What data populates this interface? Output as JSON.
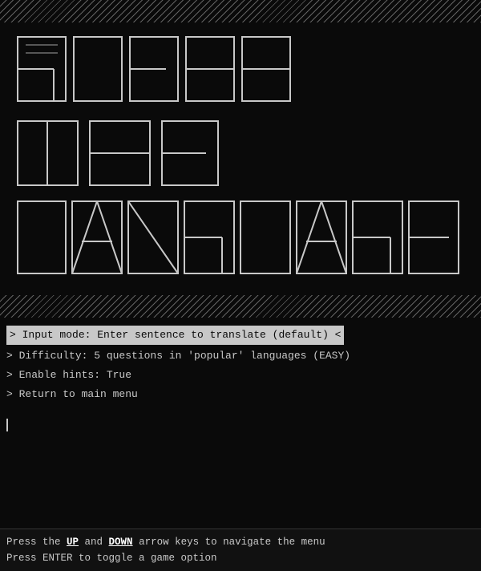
{
  "title": {
    "line1": "GUESS",
    "line2": "THE",
    "line3": "LANGUAGE"
  },
  "menu": {
    "items": [
      {
        "id": "input-mode",
        "text": "> Input mode: Enter sentence to translate (default) <",
        "selected": true
      },
      {
        "id": "difficulty",
        "text": "> Difficulty: 5 questions in 'popular' languages (EASY)",
        "selected": false
      },
      {
        "id": "hints",
        "text": "> Enable hints: True",
        "selected": false
      },
      {
        "id": "return",
        "text": "> Return to main menu",
        "selected": false
      }
    ]
  },
  "footer": {
    "line1_prefix": "Press the ",
    "line1_up": "UP",
    "line1_mid": " and ",
    "line1_down": "DOWN",
    "line1_suffix": " arrow keys to navigate the menu",
    "line2": "Press ENTER to toggle a game option"
  }
}
